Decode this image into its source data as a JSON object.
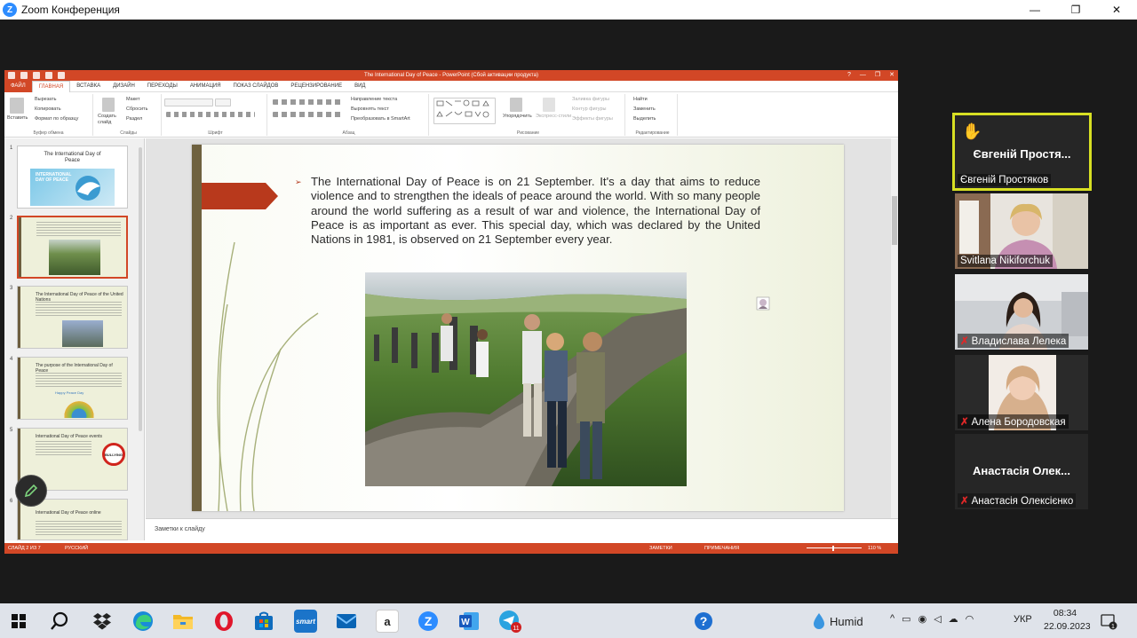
{
  "zoom": {
    "window_title": "Zoom Конференция",
    "controls": {
      "minimize": "—",
      "maximize": "❐",
      "close": "✕"
    }
  },
  "powerpoint": {
    "window_title": "The International Day of Peace - PowerPoint (Сбой активации продукта)",
    "title_controls": {
      "help": "?",
      "minimize": "—",
      "maximize": "❐",
      "close": "✕"
    },
    "tabs": [
      "ФАЙЛ",
      "ГЛАВНАЯ",
      "ВСТАВКА",
      "ДИЗАЙН",
      "ПЕРЕХОДЫ",
      "АНИМАЦИЯ",
      "ПОКАЗ СЛАЙДОВ",
      "РЕЦЕНЗИРОВАНИЕ",
      "ВИД"
    ],
    "active_tab": "ГЛАВНАЯ",
    "ribbon": {
      "clipboard": {
        "paste": "Вставить",
        "cut": "Вырезать",
        "copy": "Копировать",
        "format": "Формат по образцу",
        "label": "Буфер обмена"
      },
      "slides": {
        "new_slide": "Создать слайд",
        "layout": "Макет",
        "reset": "Сбросить",
        "section": "Раздел",
        "label": "Слайды"
      },
      "font": {
        "label": "Шрифт"
      },
      "paragraph": {
        "text_direction": "Направление текста",
        "align_text": "Выровнять текст",
        "smartart": "Преобразовать в SmartArt",
        "label": "Абзац"
      },
      "drawing": {
        "arrange": "Упорядочить",
        "quick_styles": "Экспресс-стили",
        "fill": "Заливка фигуры",
        "outline": "Контур фигуры",
        "effects": "Эффекты фигуры",
        "label": "Рисование"
      },
      "editing": {
        "find": "Найти",
        "replace": "Заменить",
        "select": "Выделить",
        "label": "Редактирование"
      }
    },
    "thumbnails": [
      {
        "num": "1",
        "title": "The International Day of Peace",
        "subtitle": "INTERNATIONAL DAY OF PEACE"
      },
      {
        "num": "2",
        "title": ""
      },
      {
        "num": "3",
        "title": "The International Day of Peace of the United Nations"
      },
      {
        "num": "4",
        "title": "The purpose of the International Day of Peace",
        "caption": "Happy Peace Day"
      },
      {
        "num": "5",
        "title": "International Day of Peace events",
        "badge": "BULLYING"
      },
      {
        "num": "6",
        "title": "International Day of Peace online"
      }
    ],
    "slide": {
      "body": "The International Day of Peace is on 21 September. It's a day that aims to reduce violence and to strengthen the ideals of peace around the world. With so many people around the world suffering as a result of war and violence, the International Day of Peace is as important as ever. This special day, which was declared by the United Nations in 1981, is observed on 21 September every year."
    },
    "notes_placeholder": "Заметки к слайду",
    "status": {
      "slide_info": "СЛАЙД 2 ИЗ 7",
      "language": "РУССКИЙ",
      "notes": "ЗАМЕТКИ",
      "comments": "ПРИМЕЧАНИЯ",
      "zoom": "110 %"
    }
  },
  "participants": [
    {
      "display": "Євгеній Простя...",
      "name": "Євгеній Простяков",
      "muted": false,
      "raised_hand": true,
      "active_speaker": true
    },
    {
      "name": "Svitlana Nikiforchuk",
      "muted": false
    },
    {
      "name": "Владислава Лелека",
      "muted": true
    },
    {
      "name": "Алена Бородовская",
      "muted": true
    },
    {
      "display": "Анастасія Олек...",
      "name": "Анастасія Олексієнко",
      "muted": true
    }
  ],
  "taskbar": {
    "weather": "Humid",
    "language": "УКР",
    "time": "08:34",
    "date": "22.09.2023",
    "notifications": "1",
    "telegram_badge": "11"
  },
  "colors": {
    "ppt_accent": "#d24726",
    "zoom_active_border": "#d7df23",
    "mic_off": "#e02828"
  }
}
